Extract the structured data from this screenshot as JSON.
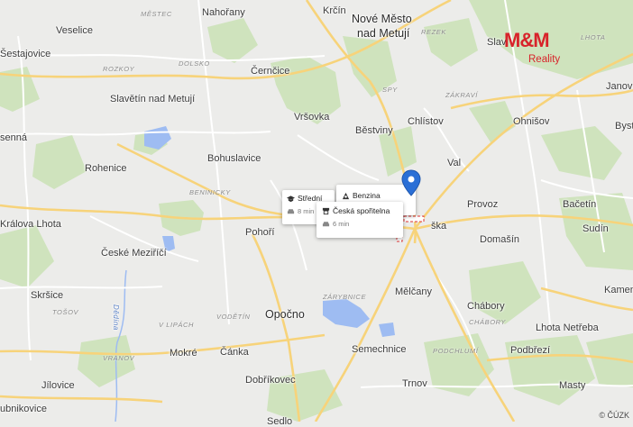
{
  "map": {
    "places": [
      {
        "id": "mestec-area",
        "text": "MĚSTEC"
      },
      {
        "id": "nahorany",
        "text": "Nahořany"
      },
      {
        "id": "krcin",
        "text": "Krčín"
      },
      {
        "id": "nove-mesto-1",
        "text": "Nové Město"
      },
      {
        "id": "nove-mesto-2",
        "text": "nad Metují"
      },
      {
        "id": "veselice",
        "text": "Veselice"
      },
      {
        "id": "sestajovice",
        "text": "Šestajovice"
      },
      {
        "id": "rozkoy-area",
        "text": "ROZKOY"
      },
      {
        "id": "dolsko-area",
        "text": "DOLSKO"
      },
      {
        "id": "cernice",
        "text": "Černčice"
      },
      {
        "id": "spy-area",
        "text": "SPY"
      },
      {
        "id": "rezek-area",
        "text": "REZEK"
      },
      {
        "id": "slavonov",
        "text": "Slav"
      },
      {
        "id": "lhota-area",
        "text": "LHOTA"
      },
      {
        "id": "slavetin",
        "text": "Slavětín nad Metují"
      },
      {
        "id": "vrsovka",
        "text": "Vršovka"
      },
      {
        "id": "zakravi-area",
        "text": "ZÁKRAVÍ"
      },
      {
        "id": "janov",
        "text": "Janov"
      },
      {
        "id": "chlistov",
        "text": "Chlístov"
      },
      {
        "id": "ohnisov",
        "text": "Ohnišov"
      },
      {
        "id": "byst",
        "text": "Byst"
      },
      {
        "id": "sennna",
        "text": "senná"
      },
      {
        "id": "bestviny",
        "text": "Běstviny"
      },
      {
        "id": "bohuslavice",
        "text": "Bohuslavice"
      },
      {
        "id": "val",
        "text": "Val"
      },
      {
        "id": "rohenice",
        "text": "Rohenice"
      },
      {
        "id": "benicky-area",
        "text": "BENINICKY"
      },
      {
        "id": "provoz",
        "text": "Provoz"
      },
      {
        "id": "bacetin",
        "text": "Bačetín"
      },
      {
        "id": "kralova-lhota",
        "text": "Králova Lhota"
      },
      {
        "id": "pohori",
        "text": "Pohoří"
      },
      {
        "id": "dobruska-part",
        "text": "ška"
      },
      {
        "id": "domasin",
        "text": "Domašín"
      },
      {
        "id": "sudin",
        "text": "Sudín"
      },
      {
        "id": "ceske-mezirici",
        "text": "České Meziříčí"
      },
      {
        "id": "skrsice",
        "text": "Skršice"
      },
      {
        "id": "melcany",
        "text": "Mělčany"
      },
      {
        "id": "kamen",
        "text": "Kamen"
      },
      {
        "id": "tosov-area",
        "text": "TOŠOV"
      },
      {
        "id": "zarybnice-area",
        "text": "ZÁRYBNICE"
      },
      {
        "id": "chabory",
        "text": "Chábory"
      },
      {
        "id": "chabory-area",
        "text": "CHÁBORY"
      },
      {
        "id": "opocno",
        "text": "Opočno"
      },
      {
        "id": "v-lipach-area",
        "text": "V LIPÁCH"
      },
      {
        "id": "vodetin-area",
        "text": "VODĚTÍN"
      },
      {
        "id": "dedina-river",
        "text": "Dědina"
      },
      {
        "id": "lhota-nebrehu",
        "text": "Lhota Netřeba"
      },
      {
        "id": "mokre",
        "text": "Mokré"
      },
      {
        "id": "canka",
        "text": "Čánka"
      },
      {
        "id": "semechnice",
        "text": "Semechnice"
      },
      {
        "id": "podchlumi-area",
        "text": "PODCHLUMÍ"
      },
      {
        "id": "podbrezi",
        "text": "Podbřezí"
      },
      {
        "id": "vranov-area",
        "text": "VRANOV"
      },
      {
        "id": "jilovice",
        "text": "Jílovice"
      },
      {
        "id": "dobrikovec",
        "text": "Dobříkovec"
      },
      {
        "id": "trnov",
        "text": "Trnov"
      },
      {
        "id": "masty",
        "text": "Masty"
      },
      {
        "id": "ubnikovice",
        "text": "ubnikovice"
      },
      {
        "id": "sedlo-bottom",
        "text": "Sedlo"
      }
    ]
  },
  "popups": {
    "stredni": {
      "title": "Střední",
      "time": "8 min"
    },
    "benzina": {
      "title": "Benzina"
    },
    "sporitelna": {
      "title": "Česká spořitelna",
      "time": "6 min"
    }
  },
  "logo": {
    "top": "M&M",
    "bottom": "Reality"
  },
  "copyright": "© ČÚZK",
  "colors": {
    "road_major": "#f7d37a",
    "road_minor": "#ffffff",
    "forest": "#cfe3bd",
    "water": "#9ebcf2",
    "pin": "#2a6fd6",
    "brand": "#d8232a"
  },
  "icons": {
    "pin": "location-pin-icon",
    "school": "school-icon",
    "car": "car-icon",
    "fuel": "fuel-icon",
    "bank": "bank-icon"
  }
}
